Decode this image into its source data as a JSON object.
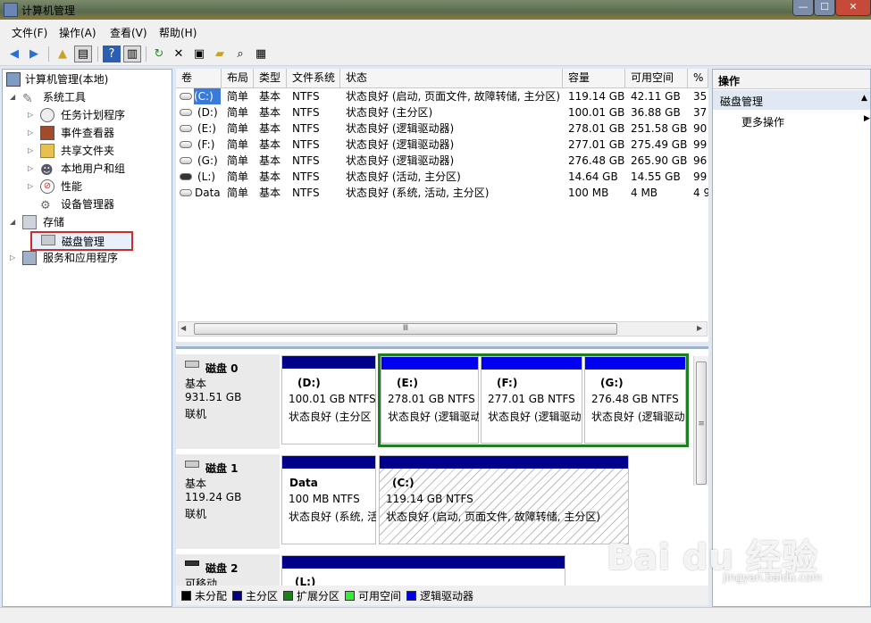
{
  "window": {
    "title": "计算机管理",
    "minimize": "—",
    "maximize": "☐",
    "close": "✕"
  },
  "menu": [
    "文件(F)",
    "操作(A)",
    "查看(V)",
    "帮助(H)"
  ],
  "tree": {
    "root": "计算机管理(本地)",
    "system_tools": "系统工具",
    "task_scheduler": "任务计划程序",
    "event_viewer": "事件查看器",
    "shared_folders": "共享文件夹",
    "local_users": "本地用户和组",
    "performance": "性能",
    "device_manager": "设备管理器",
    "storage": "存储",
    "disk_management": "磁盘管理",
    "services_apps": "服务和应用程序"
  },
  "volumes": {
    "columns": [
      "卷",
      "布局",
      "类型",
      "文件系统",
      "状态",
      "容量",
      "可用空间",
      "%"
    ],
    "rows": [
      {
        "vol": "(C:)",
        "layout": "简单",
        "type": "基本",
        "fs": "NTFS",
        "status": "状态良好 (启动, 页面文件, 故障转储, 主分区)",
        "cap": "119.14 GB",
        "free": "42.11 GB",
        "pct": "35"
      },
      {
        "vol": "(D:)",
        "layout": "简单",
        "type": "基本",
        "fs": "NTFS",
        "status": "状态良好 (主分区)",
        "cap": "100.01 GB",
        "free": "36.88 GB",
        "pct": "37"
      },
      {
        "vol": "(E:)",
        "layout": "简单",
        "type": "基本",
        "fs": "NTFS",
        "status": "状态良好 (逻辑驱动器)",
        "cap": "278.01 GB",
        "free": "251.58 GB",
        "pct": "90"
      },
      {
        "vol": "(F:)",
        "layout": "简单",
        "type": "基本",
        "fs": "NTFS",
        "status": "状态良好 (逻辑驱动器)",
        "cap": "277.01 GB",
        "free": "275.49 GB",
        "pct": "99"
      },
      {
        "vol": "(G:)",
        "layout": "简单",
        "type": "基本",
        "fs": "NTFS",
        "status": "状态良好 (逻辑驱动器)",
        "cap": "276.48 GB",
        "free": "265.90 GB",
        "pct": "96"
      },
      {
        "vol": "(L:)",
        "layout": "简单",
        "type": "基本",
        "fs": "NTFS",
        "status": "状态良好 (活动, 主分区)",
        "cap": "14.64 GB",
        "free": "14.55 GB",
        "pct": "99"
      },
      {
        "vol": "Data",
        "layout": "简单",
        "type": "基本",
        "fs": "NTFS",
        "status": "状态良好 (系统, 活动, 主分区)",
        "cap": "100 MB",
        "free": "4 MB",
        "pct": "4 9"
      }
    ]
  },
  "scroll_grip": "Ⅲ",
  "disks": [
    {
      "name": "磁盘 0",
      "type": "基本",
      "size": "931.51 GB",
      "state": "联机"
    },
    {
      "name": "磁盘 1",
      "type": "基本",
      "size": "119.24 GB",
      "state": "联机"
    },
    {
      "name": "磁盘 2",
      "type": "可移动",
      "size": "",
      "state": ""
    }
  ],
  "partitions": {
    "d": {
      "label": "(D:)",
      "size": "100.01 GB NTFS",
      "status": "状态良好 (主分区"
    },
    "e": {
      "label": "(E:)",
      "size": "278.01 GB NTFS",
      "status": "状态良好 (逻辑驱动"
    },
    "f": {
      "label": "(F:)",
      "size": "277.01 GB NTFS",
      "status": "状态良好 (逻辑驱动"
    },
    "g": {
      "label": "(G:)",
      "size": "276.48 GB NTFS",
      "status": "状态良好 (逻辑驱动"
    },
    "data": {
      "label": "Data",
      "size": "100 MB NTFS",
      "status": "状态良好 (系统, 活"
    },
    "c": {
      "label": "(C:)",
      "size": "119.14 GB NTFS",
      "status": "状态良好 (启动, 页面文件, 故障转储, 主分区)"
    },
    "l": {
      "label": "(L:)"
    }
  },
  "legend": [
    "未分配",
    "主分区",
    "扩展分区",
    "可用空间",
    "逻辑驱动器"
  ],
  "legend_colors": [
    "#000000",
    "#00008b",
    "#1d7f1d",
    "#33ee33",
    "#0000ee"
  ],
  "actions": {
    "header": "操作",
    "section": "磁盘管理",
    "more": "更多操作"
  },
  "watermark": {
    "logo": "Bai du 经验",
    "url": "jingyan.baidu.com"
  }
}
